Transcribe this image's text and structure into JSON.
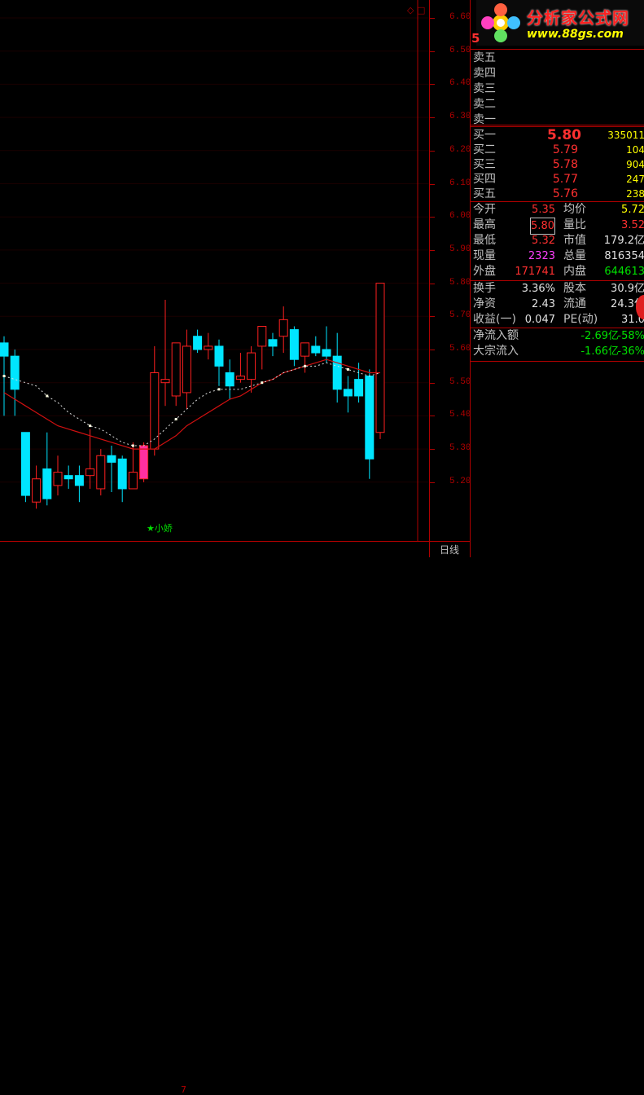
{
  "chart": {
    "y_labels": [
      "6.60",
      "6.50",
      "6.40",
      "6.30",
      "6.20",
      "6.10",
      "6.00",
      "5.90",
      "5.80",
      "5.70",
      "5.60",
      "5.50",
      "5.40",
      "5.30",
      "5.20"
    ],
    "period_label": "日线",
    "signal_label": "★小娇",
    "bottom_number": "7",
    "colors": {
      "up": "#ff2020",
      "down": "#00e5ff",
      "ma1": "#e0e0e0",
      "ma2": "#d01010",
      "highlight": "#ff30a0"
    }
  },
  "chart_data": {
    "type": "candlestick",
    "ylim": [
      5.1,
      6.65
    ],
    "candles": [
      {
        "o": 5.62,
        "h": 5.64,
        "c": 5.58,
        "l": 5.4
      },
      {
        "o": 5.58,
        "h": 5.6,
        "c": 5.48,
        "l": 5.4
      },
      {
        "o": 5.35,
        "h": 5.35,
        "c": 5.16,
        "l": 5.14
      },
      {
        "o": 5.14,
        "h": 5.25,
        "c": 5.21,
        "l": 5.12
      },
      {
        "o": 5.24,
        "h": 5.35,
        "c": 5.15,
        "l": 5.13
      },
      {
        "o": 5.19,
        "h": 5.28,
        "c": 5.23,
        "l": 5.16
      },
      {
        "o": 5.22,
        "h": 5.25,
        "c": 5.21,
        "l": 5.18
      },
      {
        "o": 5.22,
        "h": 5.25,
        "c": 5.19,
        "l": 5.14
      },
      {
        "o": 5.22,
        "h": 5.36,
        "c": 5.24,
        "l": 5.18
      },
      {
        "o": 5.18,
        "h": 5.3,
        "c": 5.28,
        "l": 5.16
      },
      {
        "o": 5.28,
        "h": 5.31,
        "c": 5.26,
        "l": 5.17
      },
      {
        "o": 5.27,
        "h": 5.28,
        "c": 5.18,
        "l": 5.14
      },
      {
        "o": 5.18,
        "h": 5.32,
        "c": 5.23,
        "l": 5.18
      },
      {
        "o": 5.21,
        "h": 5.32,
        "c": 5.31,
        "l": 5.2
      },
      {
        "o": 5.3,
        "h": 5.61,
        "c": 5.53,
        "l": 5.28
      },
      {
        "o": 5.5,
        "h": 5.75,
        "c": 5.51,
        "l": 5.43
      },
      {
        "o": 5.46,
        "h": 5.58,
        "c": 5.62,
        "l": 5.43
      },
      {
        "o": 5.47,
        "h": 5.66,
        "c": 5.61,
        "l": 5.42
      },
      {
        "o": 5.64,
        "h": 5.66,
        "c": 5.6,
        "l": 5.59
      },
      {
        "o": 5.6,
        "h": 5.65,
        "c": 5.61,
        "l": 5.57
      },
      {
        "o": 5.61,
        "h": 5.63,
        "c": 5.55,
        "l": 5.49
      },
      {
        "o": 5.53,
        "h": 5.57,
        "c": 5.49,
        "l": 5.45
      },
      {
        "o": 5.51,
        "h": 5.59,
        "c": 5.52,
        "l": 5.5
      },
      {
        "o": 5.51,
        "h": 5.61,
        "c": 5.59,
        "l": 5.47
      },
      {
        "o": 5.61,
        "h": 5.67,
        "c": 5.67,
        "l": 5.54
      },
      {
        "o": 5.63,
        "h": 5.65,
        "c": 5.61,
        "l": 5.58
      },
      {
        "o": 5.64,
        "h": 5.73,
        "c": 5.69,
        "l": 5.59
      },
      {
        "o": 5.66,
        "h": 5.67,
        "c": 5.57,
        "l": 5.55
      },
      {
        "o": 5.58,
        "h": 5.62,
        "c": 5.62,
        "l": 5.53
      },
      {
        "o": 5.61,
        "h": 5.64,
        "c": 5.59,
        "l": 5.58
      },
      {
        "o": 5.6,
        "h": 5.67,
        "c": 5.58,
        "l": 5.56
      },
      {
        "o": 5.58,
        "h": 5.65,
        "c": 5.48,
        "l": 5.44
      },
      {
        "o": 5.48,
        "h": 5.52,
        "c": 5.46,
        "l": 5.41
      },
      {
        "o": 5.51,
        "h": 5.56,
        "c": 5.46,
        "l": 5.44
      },
      {
        "o": 5.52,
        "h": 5.54,
        "c": 5.27,
        "l": 5.21
      },
      {
        "o": 5.35,
        "h": 5.8,
        "c": 5.8,
        "l": 5.33
      }
    ],
    "ma_short": [
      5.52,
      5.51,
      5.5,
      5.49,
      5.46,
      5.44,
      5.41,
      5.39,
      5.37,
      5.36,
      5.34,
      5.32,
      5.31,
      5.31,
      5.33,
      5.36,
      5.39,
      5.42,
      5.45,
      5.47,
      5.48,
      5.48,
      5.48,
      5.49,
      5.5,
      5.51,
      5.53,
      5.54,
      5.55,
      5.55,
      5.56,
      5.55,
      5.54,
      5.53,
      5.52,
      5.53
    ],
    "ma_long": [
      5.47,
      5.45,
      5.43,
      5.41,
      5.39,
      5.37,
      5.36,
      5.35,
      5.34,
      5.33,
      5.32,
      5.31,
      5.3,
      5.3,
      5.3,
      5.32,
      5.34,
      5.37,
      5.39,
      5.41,
      5.43,
      5.45,
      5.46,
      5.48,
      5.5,
      5.51,
      5.53,
      5.54,
      5.55,
      5.56,
      5.57,
      5.56,
      5.55,
      5.54,
      5.53,
      5.53
    ]
  },
  "logo": {
    "title": "分析家公式网",
    "url": "www.88gs.com"
  },
  "code_label": "5",
  "toolbar_icons": "◇ □",
  "panel": {
    "sell": [
      {
        "label": "卖五"
      },
      {
        "label": "卖四"
      },
      {
        "label": "卖三"
      },
      {
        "label": "卖二"
      },
      {
        "label": "卖一"
      }
    ],
    "buy": [
      {
        "label": "买一",
        "price": "5.80",
        "vol": "335011"
      },
      {
        "label": "买二",
        "price": "5.79",
        "vol": "104"
      },
      {
        "label": "买三",
        "price": "5.78",
        "vol": "904"
      },
      {
        "label": "买四",
        "price": "5.77",
        "vol": "247"
      },
      {
        "label": "买五",
        "price": "5.76",
        "vol": "238"
      }
    ],
    "stats1": [
      {
        "l1": "今开",
        "v1": "5.35",
        "l2": "均价",
        "v2": "5.72"
      },
      {
        "l1": "最高",
        "v1": "5.80",
        "l2": "量比",
        "v2": "3.52"
      },
      {
        "l1": "最低",
        "v1": "5.32",
        "l2": "市值",
        "v2": "179.2亿"
      },
      {
        "l1": "现量",
        "v1": "2323",
        "l2": "总量",
        "v2": "816354"
      },
      {
        "l1": "外盘",
        "v1": "171741",
        "l2": "内盘",
        "v2": "644613"
      }
    ],
    "stats2": [
      {
        "l1": "换手",
        "v1": "3.36%",
        "l2": "股本",
        "v2": "30.9亿"
      },
      {
        "l1": "净资",
        "v1": "2.43",
        "l2": "流通",
        "v2": "24.3亿"
      },
      {
        "l1": "收益(一)",
        "v1": "0.047",
        "l2": "PE(动)",
        "v2": "31.0"
      }
    ],
    "flow": [
      {
        "l": "净流入额",
        "v": "-2.69亿",
        "p": "-58%"
      },
      {
        "l": "大宗流入",
        "v": "-1.66亿",
        "p": "-36%"
      }
    ]
  }
}
